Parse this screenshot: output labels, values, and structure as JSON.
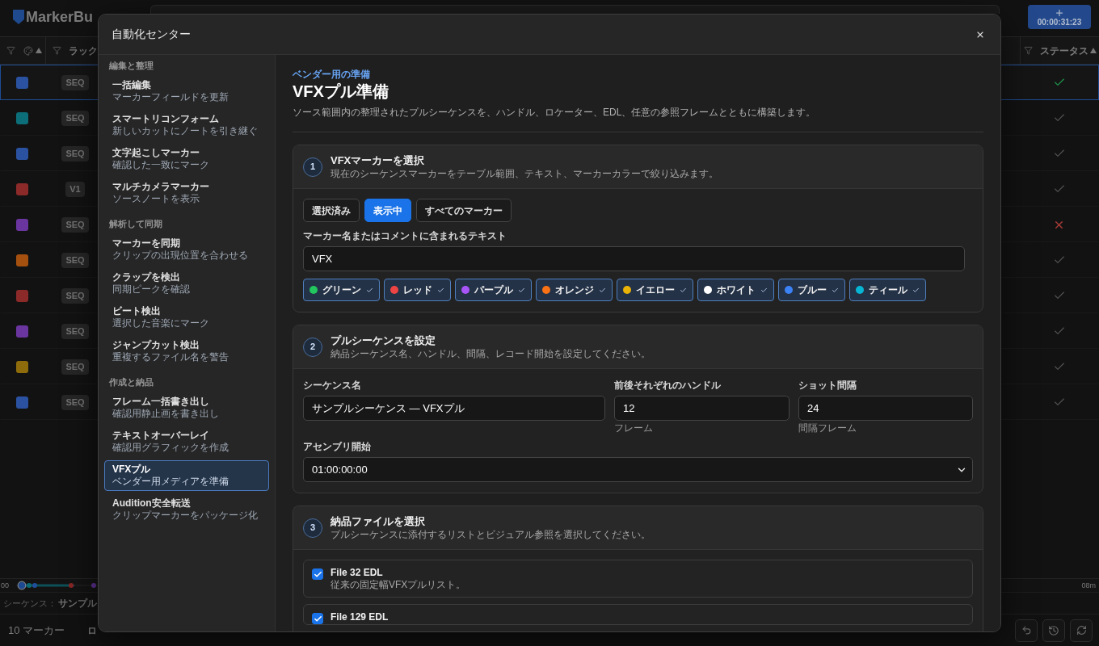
{
  "app": {
    "logo": "MarkerBu",
    "timecode": "00:00:31:23"
  },
  "table": {
    "header_left": [
      {
        "kind": "color",
        "sorted": true
      },
      {
        "kind": "text",
        "label": "ラック"
      }
    ],
    "header_right": [
      {
        "kind": "text",
        "label": "ステータス",
        "sorted": true
      }
    ],
    "rows": [
      {
        "color": "#2a52a0",
        "tag": "SEQ",
        "status": {
          "kind": "check"
        },
        "selected": true
      },
      {
        "color": "#0c6e78",
        "tag": "SEQ",
        "status": {
          "kind": "check"
        },
        "selected": false
      },
      {
        "color": "#2a52a0",
        "tag": "SEQ",
        "status": {
          "kind": "check"
        },
        "selected": false
      },
      {
        "color": "#8c2a2a",
        "tag": "V1",
        "status": {
          "kind": "check"
        },
        "selected": false
      },
      {
        "color": "#6b35a0",
        "tag": "SEQ",
        "status": {
          "kind": "cross"
        },
        "selected": false
      },
      {
        "color": "#a5500f",
        "tag": "SEQ",
        "status": {
          "kind": "check"
        },
        "selected": false
      },
      {
        "color": "#8c2a2a",
        "tag": "SEQ",
        "status": {
          "kind": "check"
        },
        "selected": false
      },
      {
        "color": "#6b35a0",
        "tag": "SEQ",
        "status": {
          "kind": "check"
        },
        "selected": false
      },
      {
        "color": "#8f6c0b",
        "tag": "SEQ",
        "status": {
          "kind": "check"
        },
        "selected": false
      },
      {
        "color": "#2a52a0",
        "tag": "SEQ",
        "status": {
          "kind": "check"
        },
        "selected": false
      }
    ]
  },
  "timeline": {
    "start_label": "00",
    "end_label": "08m"
  },
  "sequence": {
    "label": "シーケンス：",
    "value": "サンプル"
  },
  "footer": {
    "count": "10 マーカー",
    "log": "ロ"
  },
  "modal": {
    "title": "自動化センター",
    "sidebar": [
      {
        "heading": "編集と整理",
        "items": [
          {
            "title": "一括編集",
            "subtitle": "マーカーフィールドを更新",
            "selected": false
          },
          {
            "title": "スマートリコンフォーム",
            "subtitle": "新しいカットにノートを引き継ぐ",
            "selected": false
          },
          {
            "title": "文字起こしマーカー",
            "subtitle": "確認した一致にマーク",
            "selected": false
          },
          {
            "title": "マルチカメラマーカー",
            "subtitle": "ソースノートを表示",
            "selected": false
          }
        ]
      },
      {
        "heading": "解析して同期",
        "items": [
          {
            "title": "マーカーを同期",
            "subtitle": "クリップの出現位置を合わせる",
            "selected": false
          },
          {
            "title": "クラップを検出",
            "subtitle": "同期ピークを確認",
            "selected": false
          },
          {
            "title": "ビート検出",
            "subtitle": "選択した音楽にマーク",
            "selected": false
          },
          {
            "title": "ジャンプカット検出",
            "subtitle": "重複するファイル名を警告",
            "selected": false
          }
        ]
      },
      {
        "heading": "作成と納品",
        "items": [
          {
            "title": "フレーム一括書き出し",
            "subtitle": "確認用静止画を書き出し",
            "selected": false
          },
          {
            "title": "テキストオーバーレイ",
            "subtitle": "確認用グラフィックを作成",
            "selected": false
          },
          {
            "title": "VFXプル",
            "subtitle": "ベンダー用メディアを準備",
            "selected": true
          },
          {
            "title": "Audition安全転送",
            "subtitle": "クリップマーカーをパッケージ化",
            "selected": false
          }
        ]
      }
    ],
    "page": {
      "eyebrow": "ベンダー用の準備",
      "title": "VFXプル準備",
      "description": "ソース範囲内の整理されたプルシーケンスを、ハンドル、ロケーター、EDL、任意の参照フレームとともに構築します。",
      "steps": [
        {
          "kind": "marker_filter",
          "number": "1",
          "title": "VFXマーカーを選択",
          "subtitle": "現在のシーケンスマーカーをテーブル範囲、テキスト、マーカーカラーで絞り込みます。",
          "scopes": [
            {
              "label": "選択済み",
              "selected": false
            },
            {
              "label": "表示中",
              "selected": true
            },
            {
              "label": "すべてのマーカー",
              "selected": false
            }
          ],
          "search": {
            "label": "マーカー名またはコメントに含まれるテキスト",
            "value": "VFX"
          },
          "colors": [
            {
              "label": "グリーン",
              "color": "#22c55e",
              "checked": true
            },
            {
              "label": "レッド",
              "color": "#ef4444",
              "checked": true
            },
            {
              "label": "パープル",
              "color": "#a855f7",
              "checked": true
            },
            {
              "label": "オレンジ",
              "color": "#f97316",
              "checked": true
            },
            {
              "label": "イエロー",
              "color": "#eab308",
              "checked": true
            },
            {
              "label": "ホワイト",
              "color": "#ffffff",
              "checked": true
            },
            {
              "label": "ブルー",
              "color": "#3b82f6",
              "checked": true
            },
            {
              "label": "ティール",
              "color": "#06b6d4",
              "checked": true
            }
          ]
        },
        {
          "kind": "sequence_settings",
          "number": "2",
          "title": "プルシーケンスを設定",
          "subtitle": "納品シーケンス名、ハンドル、間隔、レコード開始を設定してください。",
          "fields": [
            {
              "label": "シーケンス名",
              "value": "サンプルシーケンス — VFXプル"
            },
            {
              "label": "前後それぞれのハンドル",
              "value": "12",
              "hint": "フレーム"
            },
            {
              "label": "ショット間隔",
              "value": "24",
              "hint": "間隔フレーム"
            }
          ],
          "assembly_start": {
            "label": "アセンブリ開始",
            "value": "01:00:00:00"
          }
        },
        {
          "kind": "deliverables",
          "number": "3",
          "title": "納品ファイルを選択",
          "subtitle": "プルシーケンスに添付するリストとビジュアル参照を選択してください。",
          "files": [
            {
              "title": "File 32 EDL",
              "description": "従来の固定幅VFXプルリスト。",
              "checked": true
            },
            {
              "title": "File 129 EDL",
              "checked": true
            }
          ]
        }
      ]
    }
  }
}
